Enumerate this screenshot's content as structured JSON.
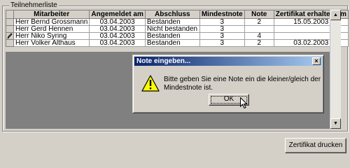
{
  "group": {
    "label": "Teilnehmerliste"
  },
  "table": {
    "columns": [
      "Mitarbeiter",
      "Angemeldet am",
      "Abschluss",
      "Mindestnote",
      "Note",
      "Zertifikat erhalten am"
    ],
    "rows": [
      {
        "indicator": "",
        "mitarbeiter": "Herr Bernd Grossmann",
        "angemeldet": "03.04.2003",
        "abschluss": "Bestanden",
        "mindestnote": "3",
        "note": "2",
        "zertifikat": "15.05.2003"
      },
      {
        "indicator": "",
        "mitarbeiter": "Herr Gerd Hennen",
        "angemeldet": "03.04.2003",
        "abschluss": "Nicht bestanden",
        "mindestnote": "3",
        "note": "",
        "zertifikat": ""
      },
      {
        "indicator": "pencil-icon",
        "mitarbeiter": "Herr Niko Syring",
        "angemeldet": "03.04.2003",
        "abschluss": "Bestanden",
        "mindestnote": "3",
        "note": "4",
        "zertifikat": ""
      },
      {
        "indicator": "",
        "mitarbeiter": "Herr Volker Althaus",
        "angemeldet": "03.04.2003",
        "abschluss": "Bestanden",
        "mindestnote": "3",
        "note": "2",
        "zertifikat": "03.02.2003"
      }
    ]
  },
  "dialog": {
    "title": "Note eingeben...",
    "message": "Bitte geben Sie eine Note ein die kleiner/gleich der Mindestnote ist.",
    "ok_label": "OK",
    "icon": "warning-icon",
    "close_icon": "close-icon"
  },
  "buttons": {
    "print_label": "Zertifikat drucken"
  },
  "colors": {
    "titlebar_start": "#0a246a",
    "titlebar_end": "#a6caf0",
    "window_bg": "#d4d0c8",
    "grid_empty": "#808080"
  }
}
